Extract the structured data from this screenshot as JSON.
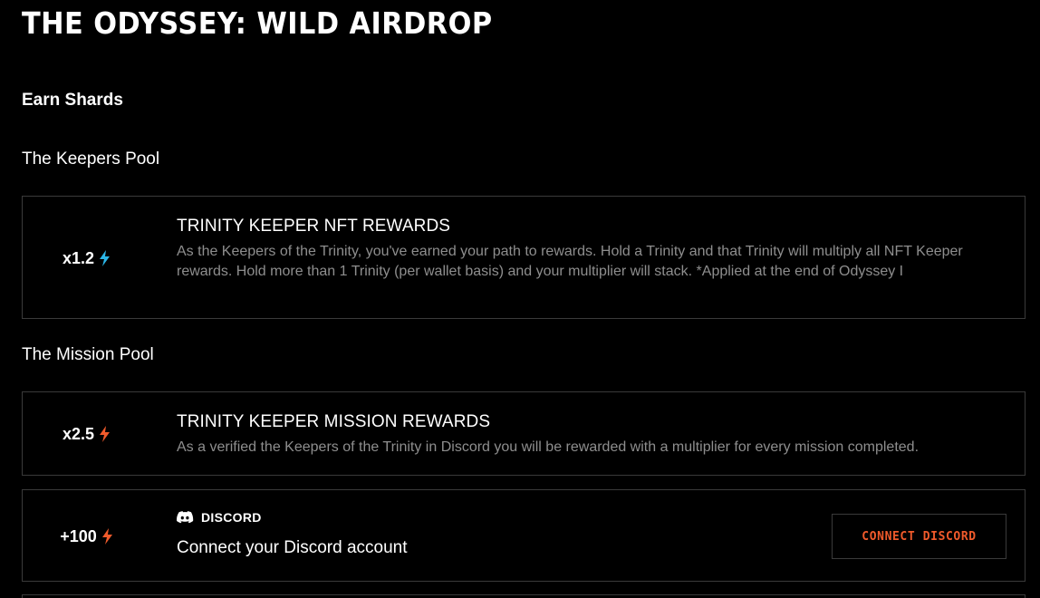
{
  "page": {
    "title": "THE ODYSSEY: WILD AIRDROP"
  },
  "earn": {
    "heading": "Earn Shards"
  },
  "keepers_pool": {
    "heading": "The Keepers Pool",
    "card": {
      "multiplier": "x1.2",
      "icon": "bolt-icon",
      "icon_color": "#2bb6e8",
      "title": "TRINITY KEEPER NFT REWARDS",
      "description": "As the Keepers of the Trinity, you've earned your path to rewards. Hold a Trinity and that Trinity will multiply all NFT Keeper rewards. Hold more than 1 Trinity (per wallet basis) and your multiplier will stack. *Applied at the end of Odyssey I"
    }
  },
  "mission_pool": {
    "heading": "The Mission Pool",
    "card": {
      "multiplier": "x2.5",
      "icon": "bolt-icon",
      "icon_color": "#f05a2b",
      "title": "TRINITY KEEPER MISSION REWARDS",
      "description": "As a verified the Keepers of the Trinity in Discord you will be rewarded with a multiplier for every mission completed."
    }
  },
  "discord_task": {
    "points": "+100",
    "icon": "bolt-icon",
    "icon_color": "#f05a2b",
    "label_icon": "discord-icon",
    "label": "DISCORD",
    "text": "Connect your Discord account",
    "button_label": "CONNECT DISCORD",
    "button_color": "#f05a2b"
  }
}
